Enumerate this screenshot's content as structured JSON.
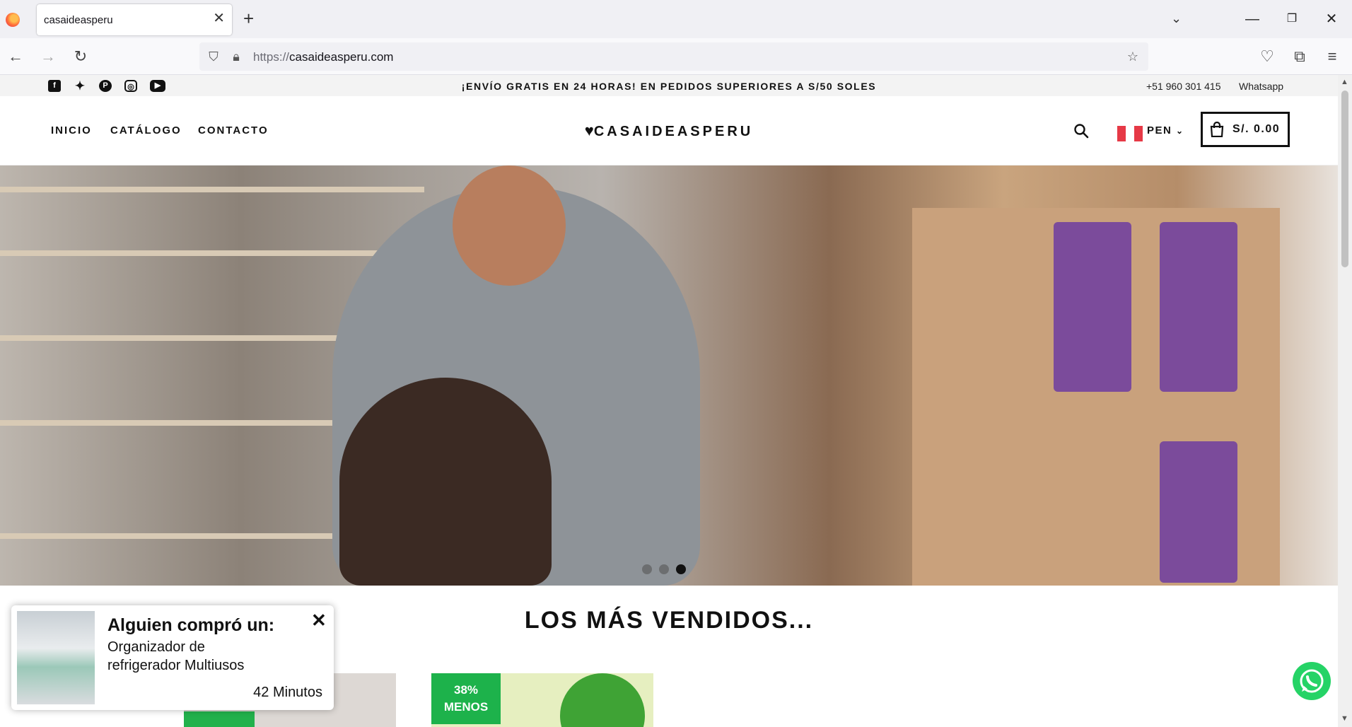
{
  "browser": {
    "tab_title": "casaideasperu",
    "url_protocol": "https://",
    "url_host": "casaideasperu.com"
  },
  "announcement": {
    "text": "¡ENVÍO GRATIS EN 24 HORAS! EN PEDIDOS SUPERIORES A S/50 SOLES",
    "phone": "+51 960 301 415",
    "whatsapp_label": "Whatsapp",
    "social_icons": [
      "facebook-icon",
      "twitter-icon",
      "pinterest-icon",
      "instagram-icon",
      "youtube-icon"
    ]
  },
  "header": {
    "menu": [
      "INICIO",
      "CATÁLOGO",
      "CONTACTO"
    ],
    "logo_heart": "♥",
    "logo_text": "CASAIDEASPERU",
    "currency": "PEN",
    "cart_total": "S/. 0.00"
  },
  "hero": {
    "slide_count": 3,
    "active_slide": 3
  },
  "best_sellers": {
    "title": "LOS MÁS VENDIDOS...",
    "badge_2_pct": "38%",
    "badge_2_word": "MENOS"
  },
  "popup": {
    "title": "Alguien compró un:",
    "product": "Organizador de refrigerador Multiusos",
    "time": "42 Minutos"
  },
  "colors": {
    "accent_green": "#1db24b",
    "whatsapp_green": "#25d366",
    "flag_red": "#e63946"
  }
}
